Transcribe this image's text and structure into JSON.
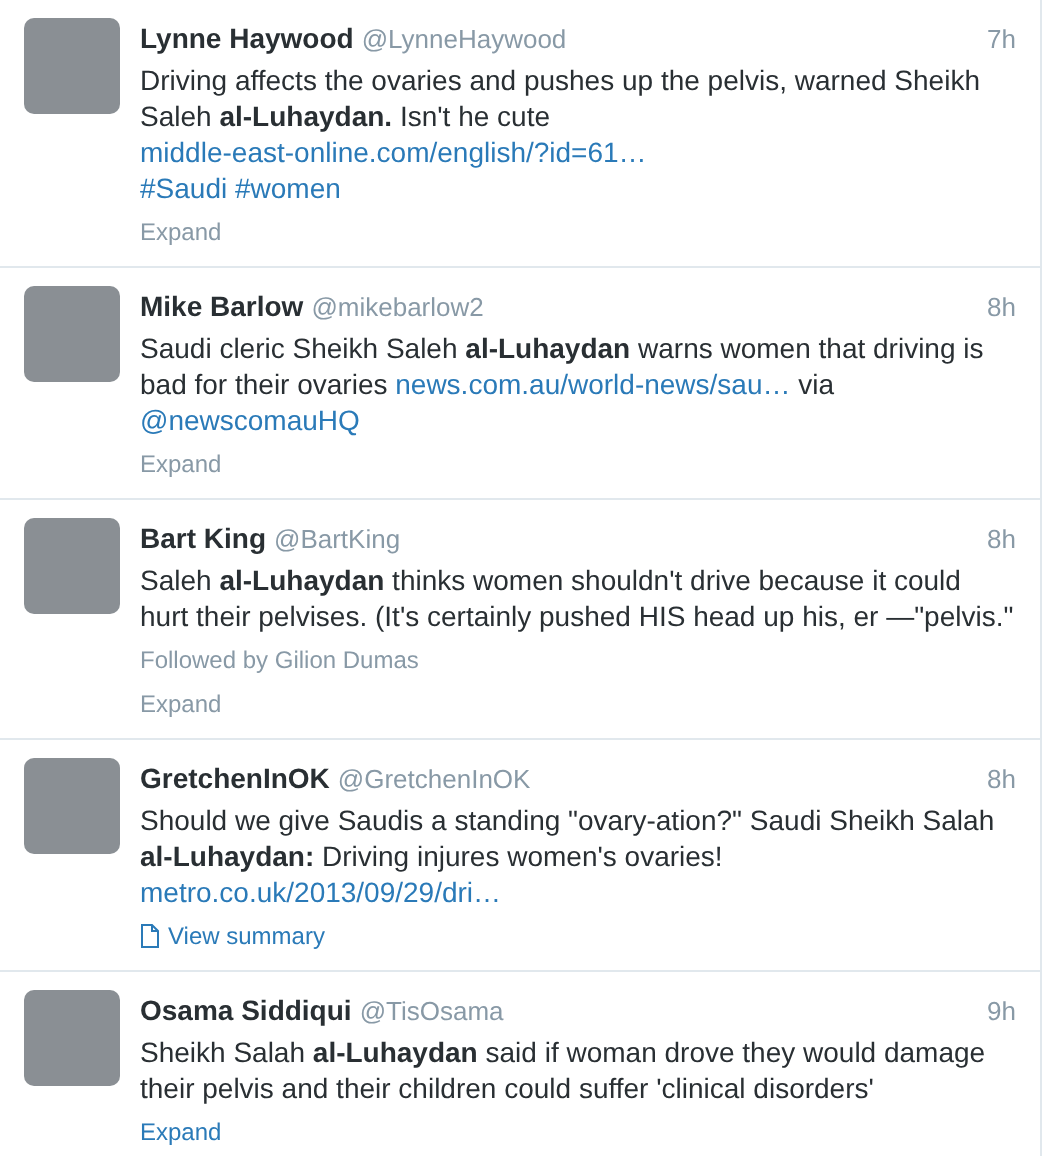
{
  "tweets": [
    {
      "name": "Lynne Haywood",
      "handle": "@LynneHaywood",
      "time": "7h",
      "body": [
        {
          "kind": "text",
          "text": "Driving affects the ovaries and pushes up the pelvis, warned Sheikh Saleh **al-Luhaydan.** Isn't he cute "
        },
        {
          "kind": "break"
        },
        {
          "kind": "link",
          "text": "middle-east-online.com/english/?id=61…"
        },
        {
          "kind": "break"
        },
        {
          "kind": "link",
          "text": "#Saudi"
        },
        {
          "kind": "space"
        },
        {
          "kind": "link",
          "text": "#women"
        }
      ],
      "action": {
        "kind": "expand",
        "label": "Expand",
        "hover": false
      }
    },
    {
      "name": "Mike Barlow",
      "handle": "@mikebarlow2",
      "time": "8h",
      "body": [
        {
          "kind": "text",
          "text": "Saudi cleric Sheikh Saleh **al-Luhaydan** warns women that driving is bad for their ovaries  "
        },
        {
          "kind": "link",
          "text": "news.com.au/world-news/sau…"
        },
        {
          "kind": "text",
          "text": " via "
        },
        {
          "kind": "link",
          "text": "@newscomauHQ"
        }
      ],
      "action": {
        "kind": "expand",
        "label": "Expand",
        "hover": false
      }
    },
    {
      "name": "Bart King",
      "handle": "@BartKing",
      "time": "8h",
      "body": [
        {
          "kind": "text",
          "text": "Saleh **al-Luhaydan** thinks women shouldn't drive because it could hurt their pelvises. (It's certainly pushed HIS head up his, er —\"pelvis.\""
        }
      ],
      "context": "Followed by Gilion Dumas",
      "action": {
        "kind": "expand",
        "label": "Expand",
        "hover": false
      }
    },
    {
      "name": "GretchenInOK",
      "handle": "@GretchenInOK",
      "time": "8h",
      "body": [
        {
          "kind": "text",
          "text": "Should we give Saudis a standing \"ovary-ation?\" Saudi Sheikh Salah **al-Luhaydan:** Driving injures women's ovaries! "
        },
        {
          "kind": "link",
          "text": "metro.co.uk/2013/09/29/dri…"
        }
      ],
      "action": {
        "kind": "summary",
        "label": "View summary",
        "hover": false
      }
    },
    {
      "name": "Osama Siddiqui",
      "handle": "@TisOsama",
      "time": "9h",
      "body": [
        {
          "kind": "text",
          "text": "Sheikh Salah **al-Luhaydan** said if woman drove they would damage their pelvis and their children could suffer 'clinical disorders'"
        }
      ],
      "action": {
        "kind": "expand",
        "label": "Expand",
        "hover": true
      }
    }
  ]
}
